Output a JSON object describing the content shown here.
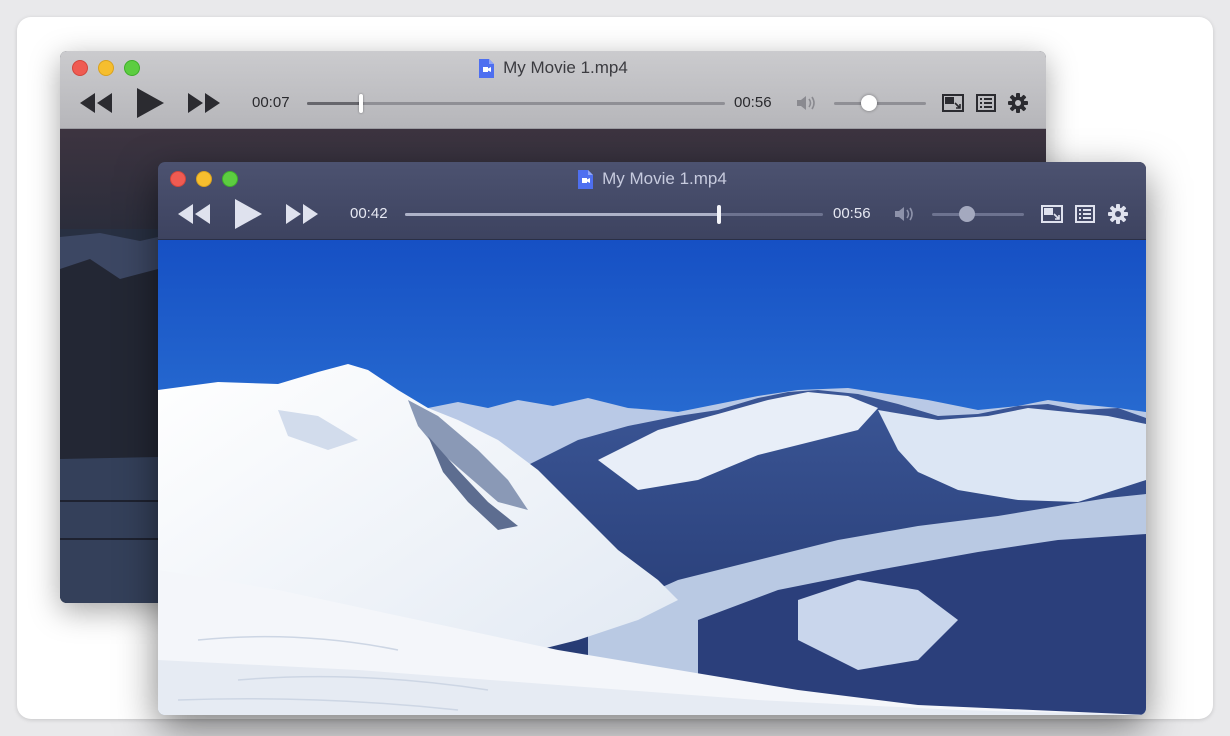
{
  "windows": {
    "back": {
      "title": "My Movie 1.mp4",
      "current_time": "00:07",
      "duration": "00:56",
      "progress": 0.13,
      "volume": 0.38
    },
    "front": {
      "title": "My Movie 1.mp4",
      "current_time": "00:42",
      "duration": "00:56",
      "progress": 0.75,
      "volume": 0.38
    }
  },
  "colors": {
    "close": "#ef5b52",
    "minimize": "#f6be2e",
    "maximize": "#5ccd40",
    "doc_icon": "#4e6ff0"
  },
  "icons": [
    "rewind-icon",
    "play-icon",
    "fast-forward-icon",
    "volume-icon",
    "picture-in-picture-icon",
    "playlist-icon",
    "gear-icon",
    "document-video-icon"
  ]
}
